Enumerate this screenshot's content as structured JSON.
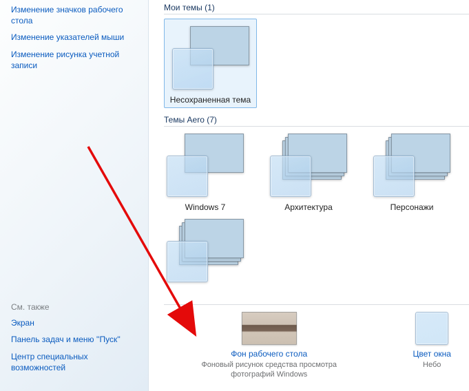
{
  "sidebar": {
    "top_links": [
      "Изменение значков рабочего стола",
      "Изменение указателей мыши",
      "Изменение рисунка учетной записи"
    ],
    "see_also_label": "См. также",
    "bottom_links": [
      "Экран",
      "Панель задач и меню ''Пуск''",
      "Центр специальных возможностей"
    ]
  },
  "sections": {
    "my_themes": {
      "heading": "Мои темы (1)"
    },
    "aero_themes": {
      "heading": "Темы Aero (7)"
    }
  },
  "themes": {
    "unsaved": "Несохраненная тема",
    "windows7": "Windows 7",
    "architecture": "Архитектура",
    "characters": "Персонажи"
  },
  "bottom": {
    "desktop_bg": {
      "link": "Фон рабочего стола",
      "desc": "Фоновый рисунок средства просмотра фотографий Windows"
    },
    "window_color": {
      "link": "Цвет окна",
      "desc": "Небо"
    }
  }
}
